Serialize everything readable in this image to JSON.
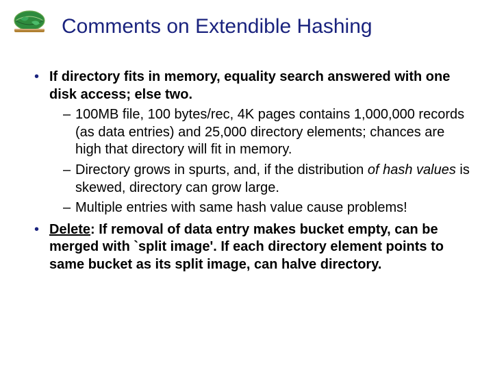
{
  "title": "Comments on Extendible Hashing",
  "bullets": {
    "b1": {
      "lead": "If directory fits in memory, equality search answered with one disk access; else two.",
      "sub": {
        "s1": "100MB file, 100 bytes/rec, 4K pages contains 1,000,000 records (as data entries) and 25,000 directory elements; chances are high that directory will fit in memory.",
        "s2_a": "Directory grows in spurts, and, if the distribution ",
        "s2_b": "of hash values",
        "s2_c": " is skewed, directory can grow large.",
        "s3": "Multiple entries with same hash value cause problems!"
      }
    },
    "b2": {
      "delete_label": "Delete",
      "rest": ":  If removal of data entry makes bucket empty, can be merged with `split image'.  If each directory element points to same bucket as its split image, can halve directory."
    }
  }
}
